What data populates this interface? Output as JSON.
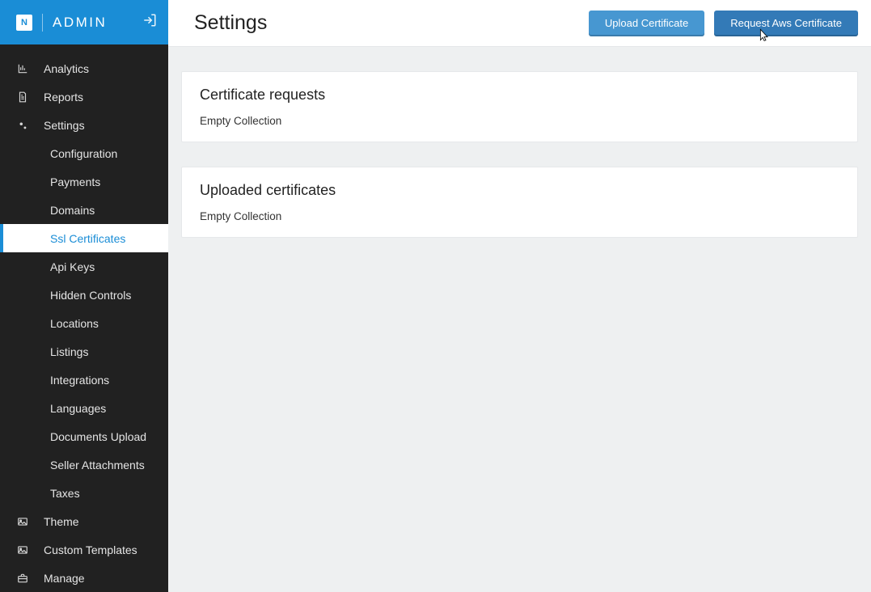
{
  "brand": {
    "badge": "N",
    "name": "ADMIN"
  },
  "sidebar": {
    "items": [
      {
        "icon": "chart-icon",
        "label": "Analytics"
      },
      {
        "icon": "doc-icon",
        "label": "Reports"
      },
      {
        "icon": "gears-icon",
        "label": "Settings"
      },
      {
        "icon": "image-icon",
        "label": "Theme"
      },
      {
        "icon": "image-icon",
        "label": "Custom Templates"
      },
      {
        "icon": "briefcase-icon",
        "label": "Manage"
      }
    ],
    "settingsSub": [
      "Configuration",
      "Payments",
      "Domains",
      "Ssl Certificates",
      "Api Keys",
      "Hidden Controls",
      "Locations",
      "Listings",
      "Integrations",
      "Languages",
      "Documents Upload",
      "Seller Attachments",
      "Taxes"
    ],
    "activeSub": "Ssl Certificates"
  },
  "page": {
    "title": "Settings"
  },
  "actions": {
    "upload": "Upload Certificate",
    "request": "Request Aws Certificate"
  },
  "cards": {
    "requests": {
      "title": "Certificate requests",
      "empty": "Empty Collection"
    },
    "uploaded": {
      "title": "Uploaded certificates",
      "empty": "Empty Collection"
    }
  }
}
